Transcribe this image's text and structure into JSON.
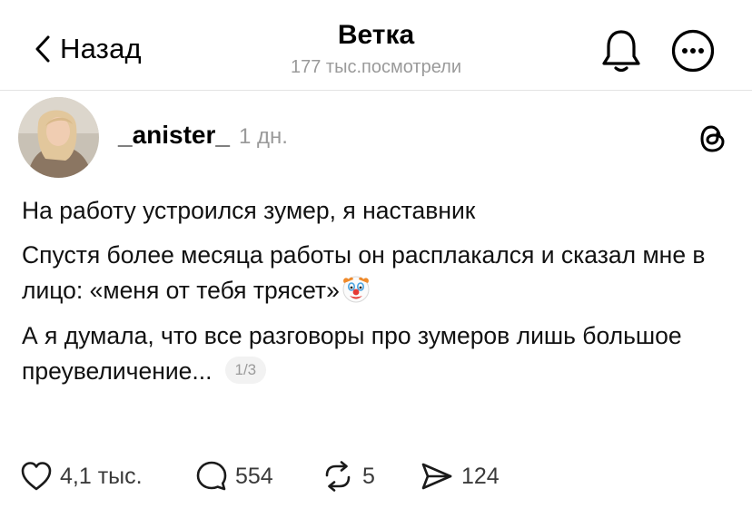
{
  "header": {
    "back_label": "Назад",
    "title": "Ветка",
    "views": "177 тыс.посмотрели"
  },
  "post": {
    "author": "_anister_",
    "time": "1 дн.",
    "paragraphs": [
      "На работу устроился зумер, я наставник",
      "Спустя более месяца работы он расплакался и сказал мне в лицо: «меня от тебя трясет»",
      "А я думала, что все разговоры про зумеров лишь большое преувеличение..."
    ],
    "emoji": "clown-face",
    "page_indicator": "1/3"
  },
  "actions": {
    "likes": "4,1 тыс.",
    "comments": "554",
    "reposts": "5",
    "shares": "124"
  },
  "colors": {
    "text": "#000000",
    "muted": "#9a9a9a",
    "divider": "#e3e3e3",
    "badge_bg": "#f2f2f2"
  }
}
